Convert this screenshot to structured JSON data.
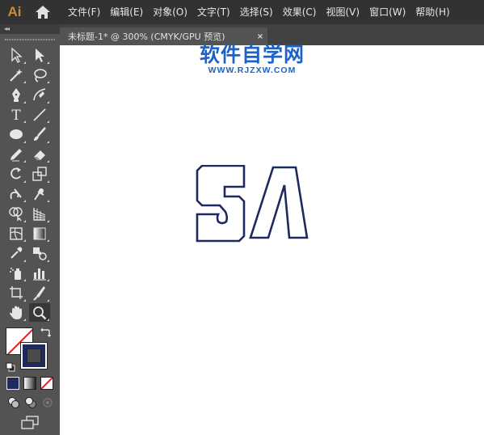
{
  "app": {
    "logo_text": "Ai"
  },
  "menu": {
    "items": [
      "文件(F)",
      "编辑(E)",
      "对象(O)",
      "文字(T)",
      "选择(S)",
      "效果(C)",
      "视图(V)",
      "窗口(W)",
      "帮助(H)"
    ]
  },
  "document_tab": {
    "title": "未标题-1* @ 300% (CMYK/GPU 预览)",
    "close_glyph": "×"
  },
  "toolbar": {
    "collapse_glyph": "◂◂",
    "tools": [
      [
        "selection-tool",
        "direct-selection-tool"
      ],
      [
        "magic-wand-tool",
        "lasso-tool"
      ],
      [
        "pen-tool",
        "curvature-tool"
      ],
      [
        "type-tool",
        "line-segment-tool"
      ],
      [
        "ellipse-tool",
        "paintbrush-tool"
      ],
      [
        "pencil-tool",
        "eraser-tool"
      ],
      [
        "rotate-tool",
        "scale-tool"
      ],
      [
        "warp-tool",
        "puppet-warp-tool"
      ],
      [
        "shape-builder-tool",
        "perspective-grid-tool"
      ],
      [
        "mesh-tool",
        "gradient-tool"
      ],
      [
        "eyedropper-tool",
        "blend-tool"
      ],
      [
        "symbol-sprayer-tool",
        "column-graph-tool"
      ],
      [
        "artboard-tool",
        "slice-tool"
      ],
      [
        "hand-tool",
        "zoom-tool"
      ]
    ],
    "active_tool": "zoom-tool",
    "type_tool_glyph": "T"
  },
  "colors": {
    "stroke_color": "#1e2a5e",
    "fill": "none",
    "artwork_stroke": "#1e2a5e",
    "watermark": "#1b63c9"
  },
  "watermark": {
    "title": "软件自学网",
    "url": "WWW.RJZXW.COM"
  }
}
